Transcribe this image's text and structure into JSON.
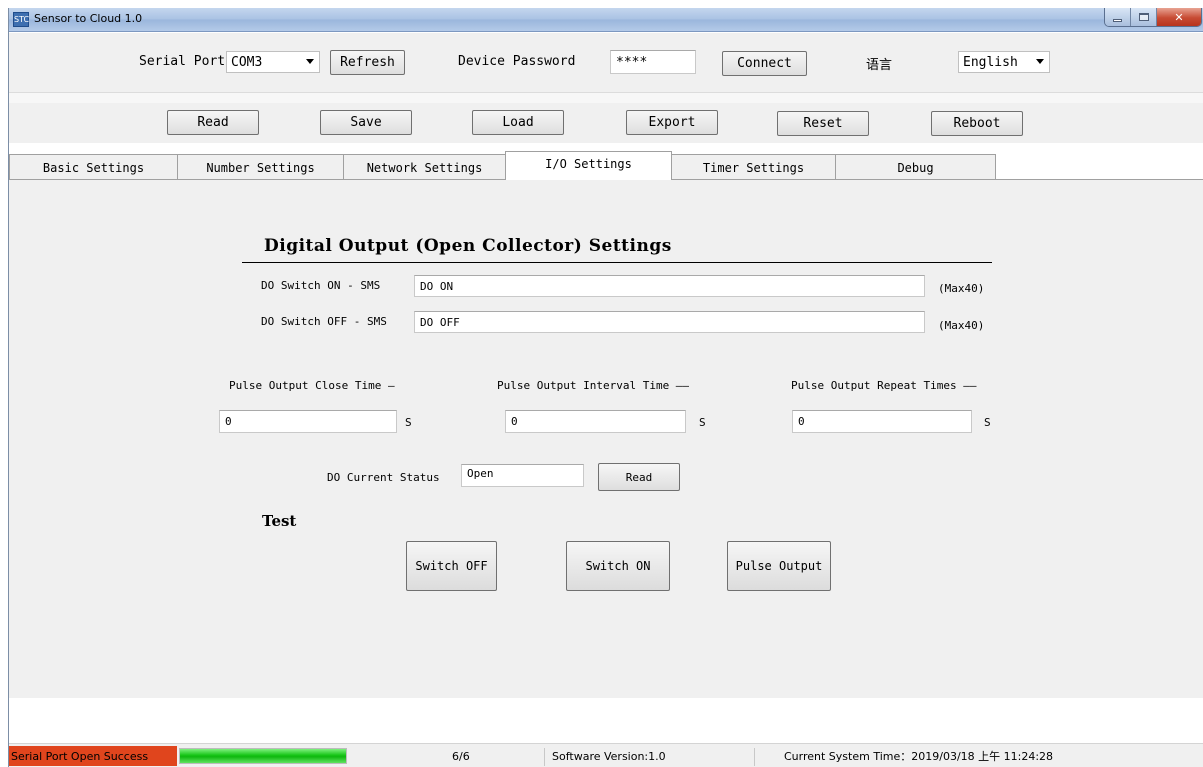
{
  "window": {
    "title": "Sensor to Cloud 1.0",
    "app_icon_text": "STC"
  },
  "toolbar": {
    "serial_port_label": "Serial Port",
    "serial_port_value": "COM3",
    "refresh_label": "Refresh",
    "device_password_label": "Device Password",
    "device_password_value": "****",
    "connect_label": "Connect",
    "language_label": "语言",
    "language_value": "English",
    "actions": [
      "Read",
      "Save",
      "Load",
      "Export",
      "Reset",
      "Reboot"
    ]
  },
  "tabs": [
    "Basic Settings",
    "Number Settings",
    "Network Settings",
    "I/O Settings",
    "Timer Settings",
    "Debug"
  ],
  "active_tab": "I/O Settings",
  "io": {
    "section_title": "Digital Output (Open Collector) Settings",
    "do_on_label": "DO Switch ON - SMS",
    "do_on_value": "DO ON",
    "do_off_label": "DO Switch OFF - SMS",
    "do_off_value": "DO OFF",
    "max_hint": "(Max40)",
    "pulse_close_label": "Pulse Output Close Time",
    "pulse_close_value": "0",
    "pulse_interval_label": "Pulse Output Interval Time",
    "pulse_interval_value": "0",
    "pulse_repeat_label": "Pulse Output Repeat Times",
    "pulse_repeat_value": "0",
    "unit": "S",
    "status_label": "DO Current Status",
    "status_value": "Open",
    "read_label": "Read",
    "test_title": "Test",
    "switch_off_label": "Switch OFF",
    "switch_on_label": "Switch ON",
    "pulse_output_label": "Pulse Output"
  },
  "statusbar": {
    "message": "Serial Port Open Success",
    "progress_fraction": 1.0,
    "count": "6/6",
    "software_version": "Software Version:1.0",
    "system_time": "Current System Time：2019/03/18 上午 11:24:28"
  },
  "colors": {
    "status_error_bg": "#e0451d",
    "progress_fill": "#16c416",
    "panel_bg": "#f0f0f0"
  }
}
